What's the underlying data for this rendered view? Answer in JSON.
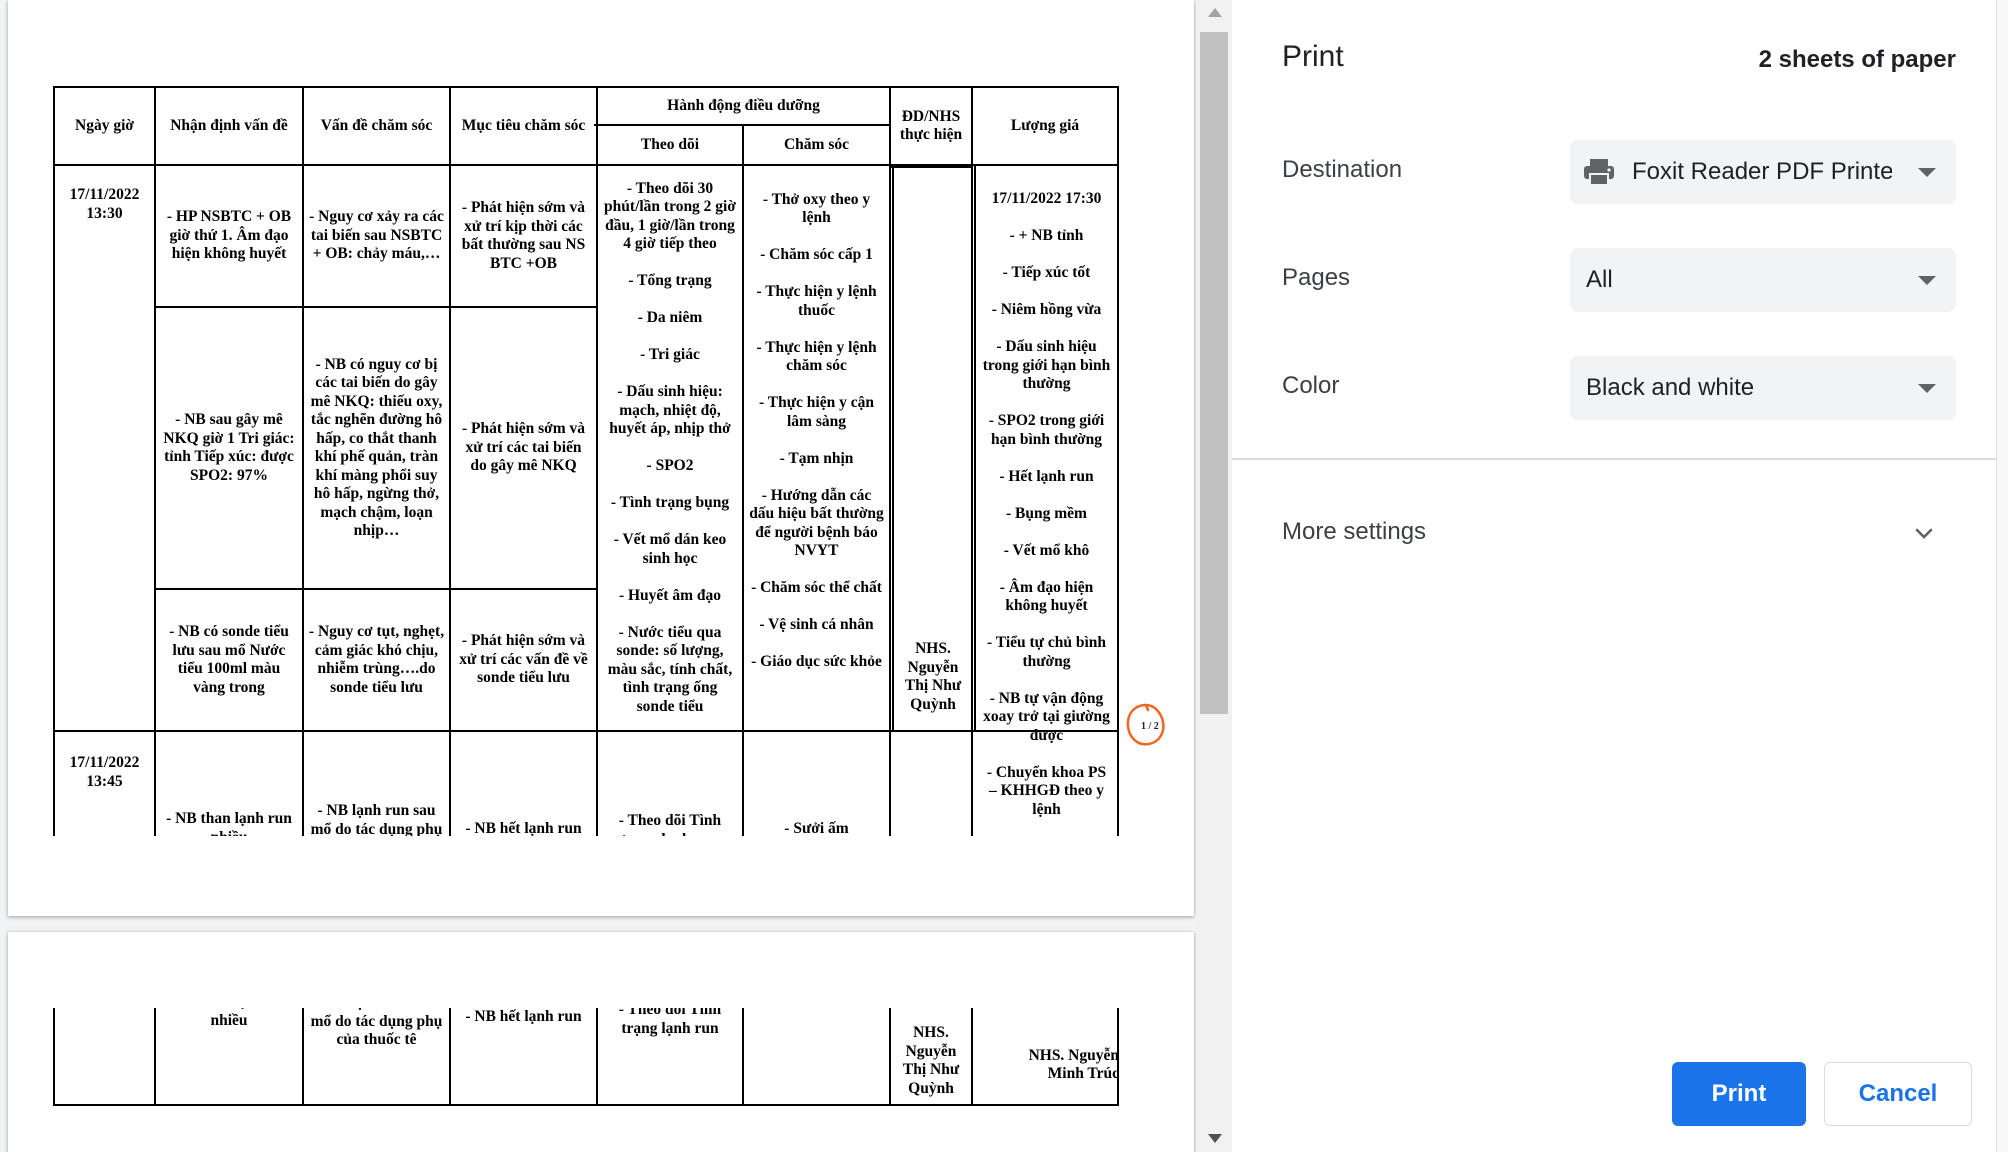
{
  "dialog": {
    "title": "Print",
    "sheets": "2 sheets of paper",
    "destination_label": "Destination",
    "destination_value": "Foxit Reader PDF Printer",
    "pages_label": "Pages",
    "pages_value": "All",
    "color_label": "Color",
    "color_value": "Black and white",
    "more_settings": "More settings",
    "print_button": "Print",
    "cancel_button": "Cancel"
  },
  "preview": {
    "page_indicator": "1 / 2",
    "headers": {
      "ngay_gio": "Ngày giờ",
      "nhan_dinh": "Nhận định vấn đề",
      "van_de": "Vấn đề chăm sóc",
      "muc_tieu": "Mục tiêu chăm sóc",
      "hanh_dong": "Hành động điều dưỡng",
      "theo_doi": "Theo dõi",
      "cham_soc": "Chăm sóc",
      "dd_nhs": "ĐD/NHS\nthực hiện",
      "luong_gia": "Lượng giá"
    },
    "row1": {
      "date": "17/11/2022\n13:30",
      "r1_nhan_dinh": "- HP NSBTC + OB\ngiờ thứ 1. Âm đạo\nhiện không huyết",
      "r1_van_de": "- Nguy cơ xảy ra các\ntai biến sau NSBTC\n+ OB: chảy máu,…",
      "r1_muc_tieu": "- Phát hiện sớm và\nxử trí kịp thời các\nbất thường sau NS\nBTC +OB",
      "r2_nhan_dinh": "- NB sau gây mê\nNKQ giờ 1 Tri giác:\ntỉnh Tiếp xúc: được\nSPO2: 97%",
      "r2_van_de": "- NB có nguy cơ bị\ncác tai biến do gây\nmê NKQ: thiếu oxy,\ntắc nghẽn đường hô\nhấp, co thắt thanh\nkhí phế quản, tràn\nkhí màng phổi suy\nhô hấp, ngừng thở,\nmạch chậm, loạn\nnhịp…",
      "r2_muc_tieu": "- Phát hiện sớm và\nxử trí các tai biến\ndo gây mê NKQ",
      "r3_nhan_dinh": "- NB có sonde tiểu\nlưu sau mổ Nước\ntiểu 100ml màu\nvàng trong",
      "r3_van_de": "- Nguy cơ tụt, nghẹt,\ncảm giác khó chịu,\nnhiễm trùng….do\nsonde tiểu lưu",
      "r3_muc_tieu": "- Phát hiện sớm và\nxử trí các vấn đề về\nsonde tiểu lưu",
      "theo_doi": "- Theo dõi 30\nphút/lần trong 2 giờ\nđầu, 1 giờ/lần trong\n4 giờ tiếp theo\n\n- Tổng trạng\n\n- Da niêm\n\n- Tri giác\n\n- Dấu sinh hiệu:\nmạch, nhiệt độ,\nhuyết áp, nhịp thở\n\n- SPO2\n\n- Tình trạng bụng\n\n- Vết mổ dán keo\nsinh học\n\n- Huyết âm đạo\n\n- Nước tiểu qua\nsonde: số lượng,\nmàu sắc, tính chất,\ntình trạng ống\nsonde tiểu",
      "cham_soc": "- Thở oxy theo y\nlệnh\n\n- Chăm sóc cấp 1\n\n- Thực hiện y lệnh\nthuốc\n\n- Thực hiện y lệnh\nchăm sóc\n\n- Thực hiện y cận\nlâm sàng\n\n- Tạm nhịn\n\n- Hướng dẫn các\ndấu hiệu bất thường\nđể người bệnh báo\nNVYT\n\n- Chăm sóc thể chất\n\n- Vệ sinh cá nhân\n\n- Giáo dục sức khỏe",
      "dd": "NHS.\nNguyễn\nThị Như\nQuỳnh",
      "luong_gia": "17/11/2022 17:30\n\n- + NB tỉnh\n\n- Tiếp xúc tốt\n\n- Niêm hồng vừa\n\n- Dấu sinh hiệu\ntrong giới hạn bình\nthường\n\n- SPO2 trong giới\nhạn bình thường\n\n- Hết lạnh run\n\n- Bụng mềm\n\n- Vết mổ khô\n\n- Âm đạo hiện\nkhông huyết\n\n- Tiểu tự chủ bình\nthường\n\n- NB tự vận động\nxoay trở tại giường\nđược\n\n- Chuyển khoa PS\n– KHHGĐ theo y\nlệnh"
    },
    "row2": {
      "date": "17/11/2022\n13:45",
      "nhan_dinh": "- NB than lạnh run\nnhiều",
      "van_de": "- NB lạnh run sau\nmổ do tác dụng phụ\ncủa thuốc tê",
      "muc_tieu": "- NB hết lạnh run",
      "theo_doi": "- Theo dõi Tình\ntrạng lạnh run",
      "cham_soc": "- Sưởi ấm",
      "dd": "NHS.\nNguyễn\nThị Như\nQuỳnh",
      "luong_gia": "NHS. Nguyễn\nMinh Trúc"
    }
  }
}
